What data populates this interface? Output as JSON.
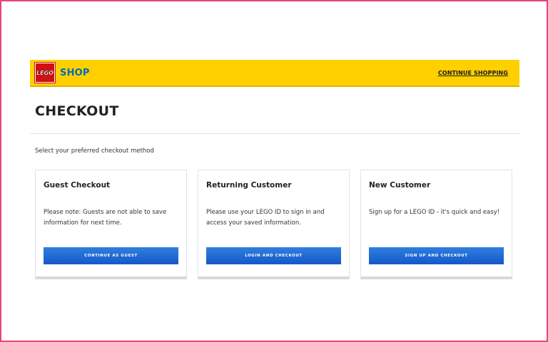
{
  "header": {
    "logo_text": "LEGO",
    "shop_label": "SHOP",
    "continue_label": "CONTINUE SHOPPING"
  },
  "page": {
    "title": "CHECKOUT",
    "subtitle": "Select your preferred checkout method"
  },
  "cards": [
    {
      "title": "Guest Checkout",
      "text": "Please note: Guests are not able to save information for next time.",
      "button": "CONTINUE AS GUEST"
    },
    {
      "title": "Returning Customer",
      "text": "Please use your LEGO ID to sign in and access your saved information.",
      "button": "LOGIN AND CHECKOUT"
    },
    {
      "title": "New Customer",
      "text": "Sign up for a LEGO ID - it's quick and easy!",
      "button": "SIGN UP AND CHECKOUT"
    }
  ],
  "colors": {
    "header_bg": "#ffcf00",
    "logo_red": "#d01012",
    "shop_blue": "#006db7",
    "button_blue": "#1458c8",
    "frame_pink": "#e8457e"
  }
}
